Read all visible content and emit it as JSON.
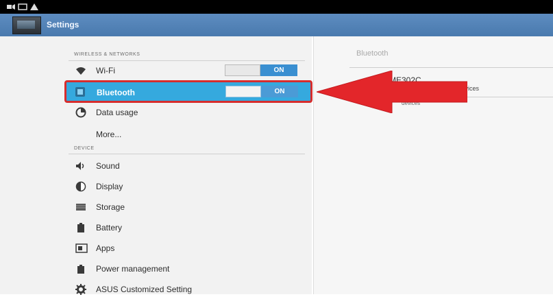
{
  "action_bar": {
    "title": "Settings"
  },
  "sections": {
    "wireless": "WIRELESS & NETWORKS",
    "device": "DEVICE"
  },
  "items": [
    {
      "id": "wifi",
      "label": "Wi-Fi",
      "icon": "wifi-icon",
      "toggle": "ON"
    },
    {
      "id": "bluetooth",
      "label": "Bluetooth",
      "icon": "bluetooth-icon",
      "toggle": "ON",
      "selected": true
    },
    {
      "id": "data",
      "label": "Data usage",
      "icon": "data-usage-icon"
    },
    {
      "id": "more",
      "label": "More..."
    },
    {
      "id": "sound",
      "label": "Sound",
      "icon": "speaker-icon"
    },
    {
      "id": "display",
      "label": "Display",
      "icon": "display-icon"
    },
    {
      "id": "storage",
      "label": "Storage",
      "icon": "storage-icon"
    },
    {
      "id": "battery",
      "label": "Battery",
      "icon": "battery-icon"
    },
    {
      "id": "apps",
      "label": "Apps",
      "icon": "apps-icon"
    },
    {
      "id": "power",
      "label": "Power management",
      "icon": "power-management-icon"
    },
    {
      "id": "asus",
      "label": "ASUS Customized Setting",
      "icon": "gear-icon"
    }
  ],
  "bluetooth_panel": {
    "title": "Bluetooth",
    "device_name": "ME302C",
    "device_subtitle": "Bluetooth devices",
    "search_label": "devices"
  },
  "colors": {
    "status_bar": "#000000",
    "action_bar": "#5d8cc0",
    "selection": "#35a9de",
    "highlight_border": "#d62d2d",
    "toggle_on": "#3a8fd1",
    "arrow": "#e3262a"
  }
}
